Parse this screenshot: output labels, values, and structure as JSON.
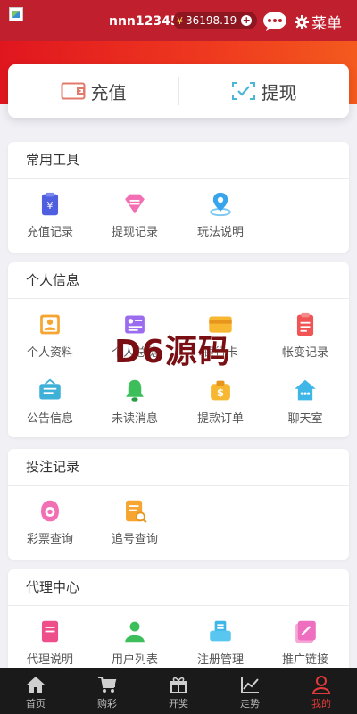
{
  "header": {
    "username": "nnn123456",
    "currency_symbol": "¥",
    "balance": "36198.19",
    "menu_label": "菜单",
    "bg_color": "#c0202e"
  },
  "quick_actions": [
    {
      "label": "充值",
      "icon": "wallet-icon"
    },
    {
      "label": "提现",
      "icon": "withdraw-check-icon"
    }
  ],
  "sections": {
    "tools": {
      "title": "常用工具",
      "items": [
        {
          "label": "充值记录",
          "icon": "recharge-record-icon"
        },
        {
          "label": "提现记录",
          "icon": "withdraw-record-icon"
        },
        {
          "label": "玩法说明",
          "icon": "location-pin-icon"
        }
      ]
    },
    "personal": {
      "title": "个人信息",
      "items": [
        {
          "label": "个人资料",
          "icon": "profile-card-icon"
        },
        {
          "label": "个人总览",
          "icon": "overview-icon"
        },
        {
          "label": "银行卡",
          "icon": "bank-card-icon"
        },
        {
          "label": "帐变记录",
          "icon": "account-change-icon"
        },
        {
          "label": "公告信息",
          "icon": "announcement-icon"
        },
        {
          "label": "未读消息",
          "icon": "bell-icon"
        },
        {
          "label": "提款订单",
          "icon": "money-bag-icon"
        },
        {
          "label": "聊天室",
          "icon": "chat-room-icon"
        }
      ]
    },
    "bets": {
      "title": "投注记录",
      "items": [
        {
          "label": "彩票查询",
          "icon": "lottery-query-icon"
        },
        {
          "label": "追号查询",
          "icon": "chase-query-icon"
        }
      ]
    },
    "agent": {
      "title": "代理中心",
      "items": [
        {
          "label": "代理说明",
          "icon": "agent-doc-icon"
        },
        {
          "label": "用户列表",
          "icon": "user-list-icon"
        },
        {
          "label": "注册管理",
          "icon": "register-manage-icon"
        },
        {
          "label": "推广链接",
          "icon": "promo-link-icon"
        }
      ]
    }
  },
  "tabbar": [
    {
      "label": "首页",
      "icon": "home-icon"
    },
    {
      "label": "购彩",
      "icon": "cart-icon"
    },
    {
      "label": "开奖",
      "icon": "gift-icon"
    },
    {
      "label": "走势",
      "icon": "trend-icon"
    },
    {
      "label": "我的",
      "icon": "user-icon",
      "active": true
    }
  ],
  "watermark": "D6源码"
}
